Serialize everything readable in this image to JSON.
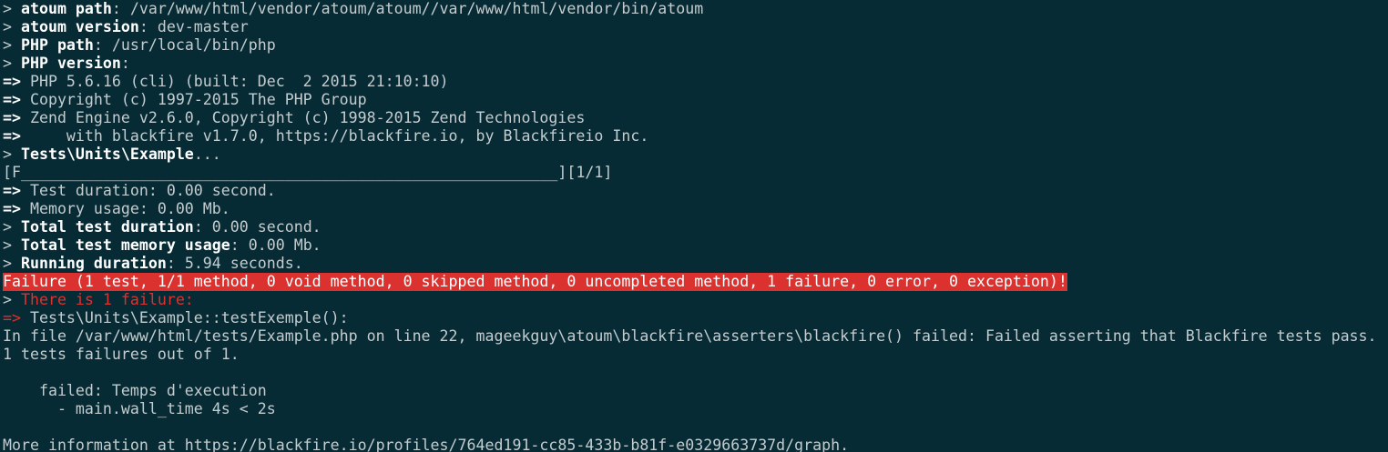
{
  "terminal": {
    "lines": [
      {
        "prefix": "> ",
        "label": "atoum path",
        "text": ": /var/www/html/vendor/atoum/atoum//var/www/html/vendor/bin/atoum"
      },
      {
        "prefix": "> ",
        "label": "atoum version",
        "text": ": dev-master"
      },
      {
        "prefix": "> ",
        "label": "PHP path",
        "text": ": /usr/local/bin/php"
      },
      {
        "prefix": "> ",
        "label": "PHP version",
        "text": ":"
      },
      {
        "prefix": "=>",
        "text": " PHP 5.6.16 (cli) (built: Dec  2 2015 21:10:10)"
      },
      {
        "prefix": "=>",
        "text": " Copyright (c) 1997-2015 The PHP Group"
      },
      {
        "prefix": "=>",
        "text": " Zend Engine v2.6.0, Copyright (c) 1998-2015 Zend Technologies"
      },
      {
        "prefix": "=>",
        "text": "     with blackfire v1.7.0, https://blackfire.io, by Blackfireio Inc."
      },
      {
        "prefix": "> ",
        "label": "Tests\\Units\\Example",
        "text": "..."
      },
      {
        "text": "[F___________________________________________________________][1/1]"
      },
      {
        "prefix": "=>",
        "text": " Test duration: 0.00 second."
      },
      {
        "prefix": "=>",
        "text": " Memory usage: 0.00 Mb."
      },
      {
        "prefix": "> ",
        "label": "Total test duration",
        "text": ": 0.00 second."
      },
      {
        "prefix": "> ",
        "label": "Total test memory usage",
        "text": ": 0.00 Mb."
      },
      {
        "prefix": "> ",
        "label": "Running duration",
        "text": ": 5.94 seconds."
      },
      {
        "banner": "Failure (1 test, 1/1 method, 0 void method, 0 skipped method, 0 uncompleted method, 1 failure, 0 error, 0 exception)!"
      },
      {
        "prefix": "> ",
        "red": "There is 1 failure:"
      },
      {
        "red_prefix": "=>",
        "text": " Tests\\Units\\Example::testExemple():"
      },
      {
        "text": "In file /var/www/html/tests/Example.php on line 22, mageekguy\\atoum\\blackfire\\asserters\\blackfire() failed: Failed asserting that Blackfire tests pass."
      },
      {
        "text": "1 tests failures out of 1."
      },
      {
        "text": ""
      },
      {
        "text": "    failed: Temps d'execution"
      },
      {
        "text": "      - main.wall_time 4s < 2s"
      },
      {
        "text": ""
      },
      {
        "text": "More information at https://blackfire.io/profiles/764ed191-cc85-433b-b81f-e0329663737d/graph."
      }
    ]
  },
  "colors": {
    "background": "#072b35",
    "foreground": "#c3ccce",
    "bold": "#ffffff",
    "failure": "#dc322f"
  }
}
